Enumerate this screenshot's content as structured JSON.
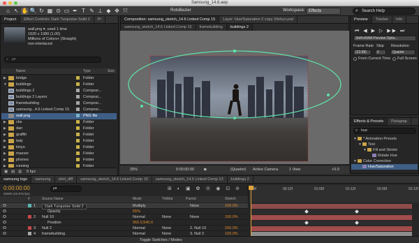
{
  "window": {
    "title": "Samsung_14.6.aep"
  },
  "toolbar": {
    "tools": [
      "⌂",
      "↖",
      "✋",
      "🔍",
      "↻",
      "▦",
      "⊙",
      "▭",
      "✒",
      "T",
      "✎",
      "⊥",
      "◆",
      "✥",
      "⤧"
    ],
    "roto_label": "RotoBezier",
    "workspace_label": "Workspace:",
    "workspace_value": "Effects",
    "search_placeholder": "Search Help"
  },
  "left_tabs": {
    "project": "Project",
    "effect_controls": "Effect Controls: Dark Turquoise Solid 2",
    "more": "Pr"
  },
  "project_info": {
    "name_line": "wall.png ▾, used 1 time",
    "size_line": "1920 x 1080 (1.00)",
    "colors_line": "Millions of Colors+ (Straight)",
    "interlace_line": "non-interlaced",
    "search_placeholder": "ρ▾"
  },
  "project_columns": {
    "name": "Name",
    "type": "Type",
    "size": "Size"
  },
  "project_items": [
    {
      "tri": "▶",
      "icon": "folder",
      "name": "bridge",
      "type": "Folder",
      "color": "#c8b24a",
      "selected": false
    },
    {
      "tri": "▼",
      "icon": "folder",
      "name": "buildings",
      "type": "Folder",
      "color": "#c8b24a",
      "selected": false
    },
    {
      "tri": "",
      "icon": "comp",
      "name": "buildings 2",
      "type": "Composi...",
      "color": "#a8a8a8",
      "selected": false
    },
    {
      "tri": "",
      "icon": "comp",
      "name": "buildings 2 Layers",
      "type": "Composi...",
      "color": "#a8a8a8",
      "selected": false
    },
    {
      "tri": "",
      "icon": "comp",
      "name": "framebuilding",
      "type": "Composi...",
      "color": "#a8a8a8",
      "selected": false
    },
    {
      "tri": "",
      "icon": "comp",
      "name": "samsung...4.6 Linked Comp 15",
      "type": "Composi...",
      "color": "#a8a8a8",
      "selected": false
    },
    {
      "tri": "",
      "icon": "img",
      "name": "wall.png",
      "type": "PNG file",
      "color": "#7bb1c9",
      "selected": true
    },
    {
      "tri": "▶",
      "icon": "folder",
      "name": "cbs",
      "type": "Folder",
      "color": "#c8b24a",
      "selected": false
    },
    {
      "tri": "▶",
      "icon": "folder",
      "name": "dan",
      "type": "Folder",
      "color": "#c8b24a",
      "selected": false
    },
    {
      "tri": "▶",
      "icon": "folder",
      "name": "graffiti",
      "type": "Folder",
      "color": "#c8b24a",
      "selected": false
    },
    {
      "tri": "▶",
      "icon": "folder",
      "name": "italy",
      "type": "Folder",
      "color": "#c8b24a",
      "selected": false
    },
    {
      "tri": "▶",
      "icon": "folder",
      "name": "kinyo",
      "type": "Folder",
      "color": "#c8b24a",
      "selected": false
    },
    {
      "tri": "▶",
      "icon": "folder",
      "name": "maxxer",
      "type": "Folder",
      "color": "#c8b24a",
      "selected": false
    },
    {
      "tri": "▶",
      "icon": "folder",
      "name": "phones",
      "type": "Folder",
      "color": "#c8b24a",
      "selected": false
    },
    {
      "tri": "▶",
      "icon": "folder",
      "name": "running",
      "type": "Folder",
      "color": "#c8b24a",
      "selected": false
    }
  ],
  "project_footer": {
    "bpc": "8 bpc"
  },
  "viewer_tabs": {
    "composition": "Composition: samsung_sketch_14.6 Linked Comp 15",
    "layer": "Layer: Hue/Saturation 2 copy 3/tokyo.psd"
  },
  "breadcrumbs": [
    "samsung_sketch_14.6 Linked Comp 15",
    "framebuilding",
    "buildings 2"
  ],
  "viewer_controls": {
    "zoom": "25%",
    "timecode": "0:00:00:00",
    "resolution": "(Quarter)",
    "camera": "Active Camera",
    "views": "1 View",
    "offset": "+0.0"
  },
  "preview_tabs": [
    "Preview",
    "Tracker",
    "Info"
  ],
  "preview": {
    "mode": "Shift+RAM Preview Optio...",
    "frame_rate_label": "Frame Rate",
    "skip_label": "Skip",
    "resolution_label": "Resolution",
    "frame_rate": "(23.98)",
    "skip": "0",
    "resolution": "Quarter",
    "from_current": "From Current Time",
    "full_screen": "Full Screen"
  },
  "effects_tabs": [
    "Effects & Presets",
    "Paragrap"
  ],
  "effects": {
    "search_value": "hue",
    "tree": [
      {
        "indent": 0,
        "tri": "▼",
        "icon": "folder",
        "label": "* Animation Presets"
      },
      {
        "indent": 1,
        "tri": "▼",
        "icon": "folder",
        "label": "Text"
      },
      {
        "indent": 2,
        "tri": "▼",
        "icon": "folder",
        "label": "Fill and Stroke"
      },
      {
        "indent": 3,
        "tri": "",
        "icon": "fx",
        "label": "Rotate Hue"
      },
      {
        "indent": 0,
        "tri": "▼",
        "icon": "folder",
        "label": "Color Correction"
      },
      {
        "indent": 1,
        "tri": "",
        "icon": "fx",
        "label": "Hue/Saturation",
        "selected": true
      }
    ]
  },
  "timeline_tabs": [
    "samsung logo",
    "samsung",
    "shirt_diff",
    "samsung_sketch_14.6 Linked Comp 15",
    "samsung_sketch_14.6 Linked Comp 13",
    "buildings 2"
  ],
  "timeline": {
    "timecode": "0:00:00:00",
    "fps": "00000 (23.976 fps)",
    "search_placeholder": "ρ▾",
    "columns": {
      "num": "#",
      "source": "Source Name",
      "mode": "Mode",
      "trkmat": "TrkMat",
      "parent": "Parent",
      "stretch": "Stretch"
    },
    "ruler": [
      "00f",
      "00:12f",
      "01:00f",
      "01:12f",
      "02:00f",
      "02:12f"
    ],
    "toggle_label": "Toggle Switches / Modes",
    "layers": [
      {
        "num": "1",
        "name": "Dark Turquoise Solid 2",
        "mode": "Multiply",
        "trkmat": "",
        "parent": "None",
        "stretch": "100.0%",
        "color": "#5bb7b2",
        "bar": "#8d4b4b",
        "kind": "layer"
      },
      {
        "num": "",
        "name": "Opacity",
        "mode": "65%",
        "trkmat": "",
        "parent": "",
        "stretch": "",
        "color": "",
        "bar": "",
        "kind": "prop"
      },
      {
        "num": "2",
        "name": "Null 10",
        "mode": "Normal",
        "trkmat": "None",
        "parent": "None",
        "stretch": "100.0%",
        "color": "#c64848",
        "bar": "#a24c4c",
        "kind": "layer"
      },
      {
        "num": "",
        "name": "Position",
        "mode": "960.0,540.0",
        "trkmat": "",
        "parent": "",
        "stretch": "",
        "color": "",
        "bar": "",
        "kind": "prop"
      },
      {
        "num": "3",
        "name": "Null 2",
        "mode": "Normal",
        "trkmat": "None",
        "parent": "2. Null 10",
        "stretch": "200.0%",
        "color": "#c64848",
        "bar": "#a24c4c",
        "kind": "layer"
      },
      {
        "num": "4",
        "name": "framebuilding",
        "mode": "Normal",
        "trkmat": "None",
        "parent": "3. Null 2",
        "stretch": "100.0%",
        "color": "#a8a8a8",
        "bar": "#8d8d8d",
        "kind": "layer"
      }
    ]
  },
  "colors": {
    "accent": "#3f5e86",
    "mask": "#5fe0a8",
    "current_time": "#e2a43a"
  }
}
